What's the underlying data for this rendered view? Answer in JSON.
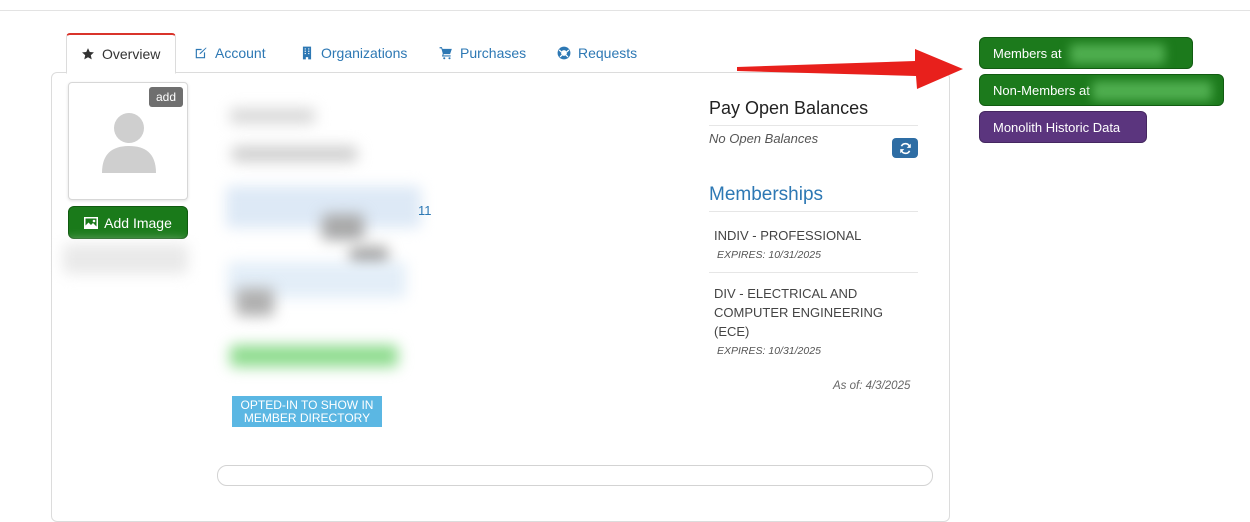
{
  "tabs": [
    {
      "label": "Overview",
      "icon": "star-icon",
      "active": true
    },
    {
      "label": "Account",
      "icon": "edit-icon"
    },
    {
      "label": "Organizations",
      "icon": "building-icon"
    },
    {
      "label": "Purchases",
      "icon": "cart-icon"
    },
    {
      "label": "Requests",
      "icon": "lifebuoy-icon"
    }
  ],
  "profile": {
    "add_badge": "add",
    "add_image_label": "Add Image",
    "contact_fragment": "11",
    "directory_badge_line1": "OPTED-IN TO SHOW IN",
    "directory_badge_line2": "MEMBER DIRECTORY"
  },
  "balances": {
    "title": "Pay Open Balances",
    "status": "No Open Balances"
  },
  "memberships": {
    "title": "Memberships",
    "items": [
      {
        "name": "INDIV - PROFESSIONAL",
        "expires": "EXPIRES: 10/31/2025"
      },
      {
        "name_lines": [
          "DIV - ELECTRICAL AND",
          "COMPUTER ENGINEERING",
          "(ECE)"
        ],
        "expires": "EXPIRES: 10/31/2025"
      }
    ],
    "as_of": "As of: 4/3/2025"
  },
  "side_buttons": {
    "members": "Members at",
    "non_members": "Non-Members at",
    "historic": "Monolith Historic Data"
  },
  "colors": {
    "accent_blue": "#2d78b4",
    "green_button": "#1c7a1c",
    "purple_button": "#5b357e",
    "annotation_arrow": "#e8201c",
    "active_tab_border": "#d9342b"
  }
}
